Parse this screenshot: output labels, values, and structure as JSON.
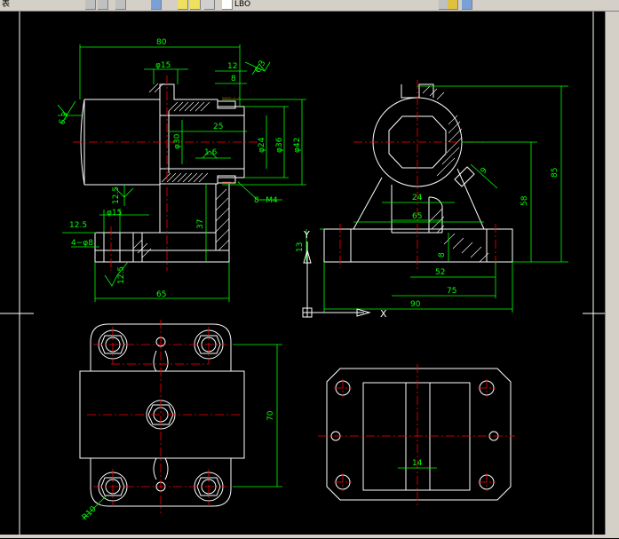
{
  "toolbar": {
    "left_text": "表",
    "layer_name": "LBO"
  },
  "colors": {
    "background": "#000000",
    "outline": "#ffffff",
    "dimension": "#00ff00",
    "centerline": "#ff0000",
    "hatch": "#ffffff",
    "dim_text": "#00ff00"
  },
  "dimensions": {
    "front_overall_width": "80",
    "front_top_hole": "φ15",
    "front_12": "12",
    "front_8": "8",
    "front_rough_63_top": "6.3",
    "front_rough_63_left": "6.3",
    "front_25": "25",
    "front_phi30": "φ30",
    "front_phi24": "φ24",
    "front_phi36": "φ36",
    "front_phi42": "φ42",
    "front_16": "1.6",
    "front_8m4": "8−M4",
    "front_125a": "12.5",
    "front_phi15b": "φ15",
    "front_125b": "12.5",
    "front_4phi8": "4−φ8",
    "front_37": "37",
    "front_125c": "12.5",
    "front_65": "65",
    "side_85": "85",
    "side_58": "58",
    "side_9": "9",
    "side_24": "24",
    "side_65": "65",
    "side_13": "13",
    "side_8": "8",
    "side_52": "52",
    "side_75": "75",
    "side_90": "90",
    "ucs_x": "X",
    "ucs_y": "Y",
    "top_70": "70",
    "top_r10": "R10",
    "bottom_14": "14"
  }
}
